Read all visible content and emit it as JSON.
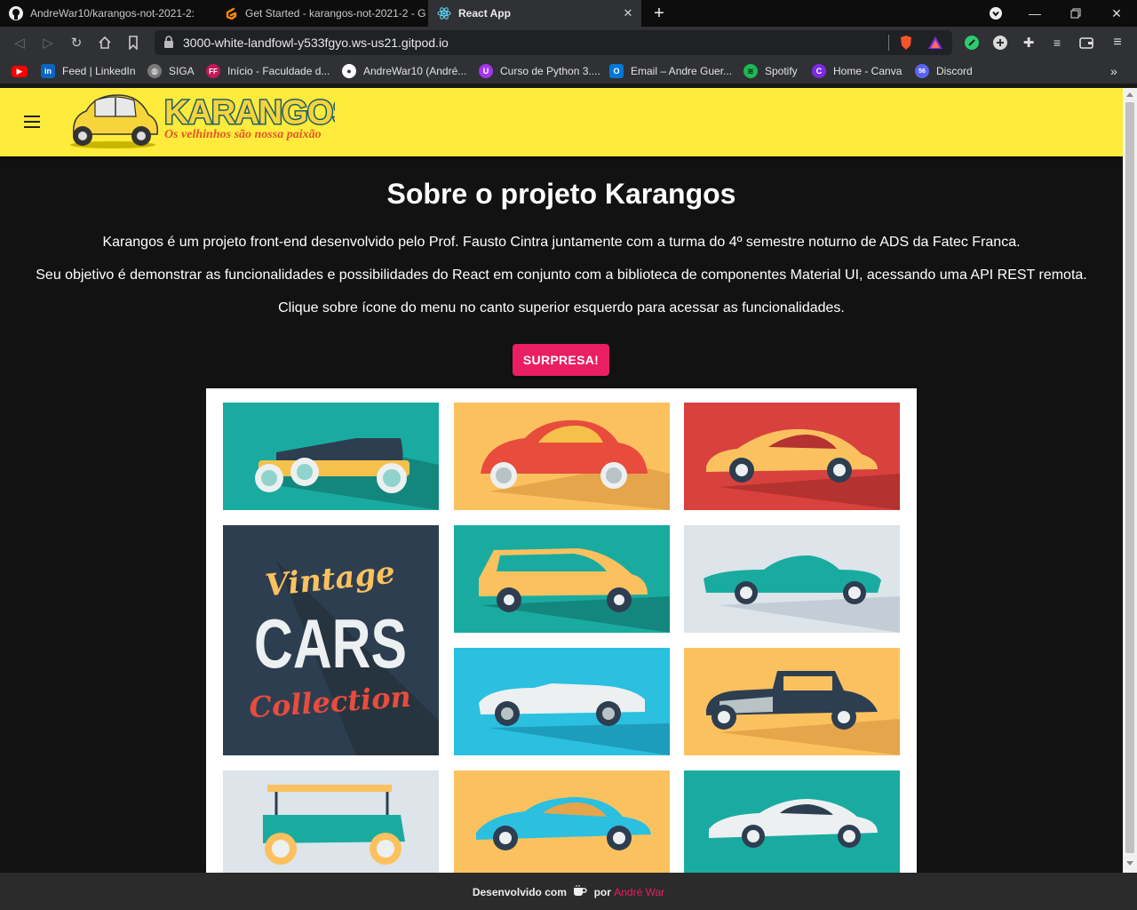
{
  "browser": {
    "tabs": [
      {
        "title": "AndreWar10/karangos-not-2021-2:",
        "icon": "github-icon"
      },
      {
        "title": "Get Started - karangos-not-2021-2 - G",
        "icon": "gitpod-icon"
      },
      {
        "title": "React App",
        "icon": "react-icon"
      }
    ],
    "url": "3000-white-landfowl-y533fgyo.ws-us21.gitpod.io",
    "bookmarks": [
      {
        "label": "",
        "icon": "youtube-icon",
        "color": "#ff0000"
      },
      {
        "label": "Feed | LinkedIn",
        "icon": "linkedin-icon",
        "color": "#0a66c2"
      },
      {
        "label": "SIGA",
        "icon": "globe-icon",
        "color": "#9e9e9e"
      },
      {
        "label": "Início - Faculdade d...",
        "icon": "ff-icon",
        "color": "#c2185b"
      },
      {
        "label": "AndreWar10 (André...",
        "icon": "github-icon",
        "color": "#ffffff"
      },
      {
        "label": "Curso de Python 3....",
        "icon": "udemy-icon",
        "color": "#a435f0"
      },
      {
        "label": "Email – Andre Guer...",
        "icon": "outlook-icon",
        "color": "#0078d4"
      },
      {
        "label": "Spotify",
        "icon": "spotify-icon",
        "color": "#1db954"
      },
      {
        "label": "Home - Canva",
        "icon": "canva-icon",
        "color": "#7d2ae8"
      },
      {
        "label": "Discord",
        "icon": "discord-icon",
        "color": "#5865f2"
      }
    ]
  },
  "app": {
    "brand": "KARANGOS",
    "tagline": "Os velhinhos são nossa paixão",
    "title": "Sobre o projeto Karangos",
    "paragraphs": [
      "Karangos é um projeto front-end desenvolvido pelo Prof. Fausto Cintra juntamente com a turma do 4º semestre noturno de ADS da Fatec Franca.",
      "Seu objetivo é demonstrar as funcionalidades e possibilidades do React em conjunto com a biblioteca de componentes Material UI, acessando uma API REST remota.",
      "Clique sobre ícone do menu no canto superior esquerdo para acessar as funcionalidades."
    ],
    "button_label": "SURPRESA!",
    "poster": {
      "line1": "Vintage",
      "line2": "CARS",
      "line3": "Collection"
    },
    "footer": {
      "prefix": "Desenvolvido com",
      "by": "por",
      "author": "André War"
    }
  },
  "colors": {
    "appbar": "#ffeb3b",
    "accent": "#e91e63",
    "background": "#121212"
  }
}
